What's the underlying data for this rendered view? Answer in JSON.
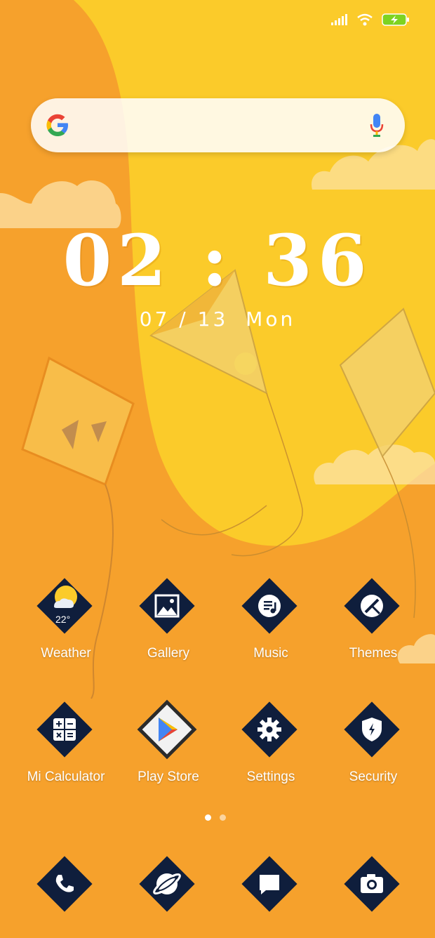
{
  "status_bar": {
    "icons": [
      "signal-icon",
      "wifi-icon",
      "battery-charging-icon"
    ],
    "battery_color": "#7ED321"
  },
  "search": {
    "placeholder": "",
    "logo": "google-g-icon",
    "voice": "microphone-icon"
  },
  "clock": {
    "time": "02 : 36",
    "date": "07 / 13",
    "weekday": "Mon"
  },
  "apps": [
    {
      "label": "Weather",
      "icon": "weather-icon",
      "badge": "22°"
    },
    {
      "label": "Gallery",
      "icon": "gallery-icon"
    },
    {
      "label": "Music",
      "icon": "music-icon"
    },
    {
      "label": "Themes",
      "icon": "themes-icon"
    },
    {
      "label": "Mi Calculator",
      "icon": "calculator-icon"
    },
    {
      "label": "Play Store",
      "icon": "play-store-icon"
    },
    {
      "label": "Settings",
      "icon": "gear-icon"
    },
    {
      "label": "Security",
      "icon": "shield-icon"
    }
  ],
  "pages": {
    "count": 2,
    "current": 1
  },
  "dock": [
    {
      "icon": "phone-icon"
    },
    {
      "icon": "browser-icon"
    },
    {
      "icon": "messages-icon"
    },
    {
      "icon": "camera-icon"
    }
  ],
  "colors": {
    "tile": "#0F1E3C",
    "wall_yellow": "#FBCB2A",
    "wall_orange": "#F6A12C",
    "text": "#FFFFFF"
  }
}
